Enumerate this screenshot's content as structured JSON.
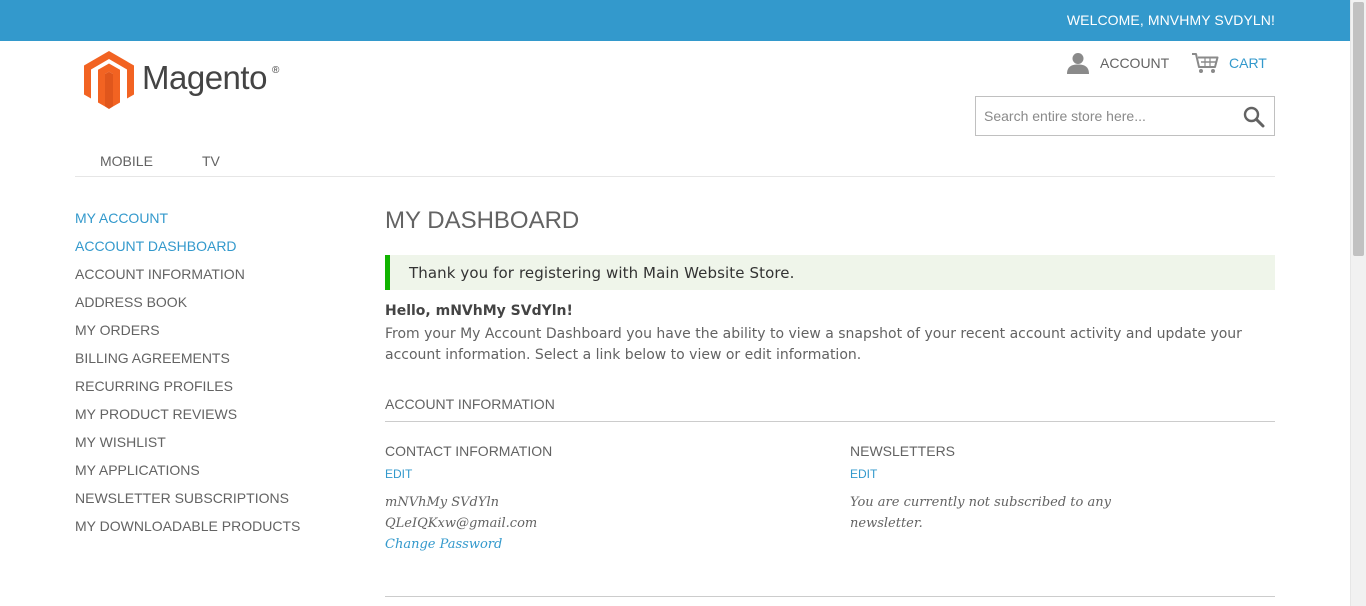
{
  "header": {
    "welcome": "WELCOME, MNVHMY SVDYLN!",
    "logo_text": "Magento",
    "account_label": "ACCOUNT",
    "cart_label": "CART",
    "search_placeholder": "Search entire store here..."
  },
  "nav": {
    "items": [
      "MOBILE",
      "TV"
    ]
  },
  "sidebar": {
    "title": "MY ACCOUNT",
    "items": [
      {
        "label": "ACCOUNT DASHBOARD",
        "active": true
      },
      {
        "label": "ACCOUNT INFORMATION"
      },
      {
        "label": "ADDRESS BOOK"
      },
      {
        "label": "MY ORDERS"
      },
      {
        "label": "BILLING AGREEMENTS"
      },
      {
        "label": "RECURRING PROFILES"
      },
      {
        "label": "MY PRODUCT REVIEWS"
      },
      {
        "label": "MY WISHLIST"
      },
      {
        "label": "MY APPLICATIONS"
      },
      {
        "label": "NEWSLETTER SUBSCRIPTIONS"
      },
      {
        "label": "MY DOWNLOADABLE PRODUCTS"
      }
    ]
  },
  "main": {
    "title": "MY DASHBOARD",
    "success_message": "Thank you for registering with Main Website Store.",
    "hello": "Hello, mNVhMy SVdYln!",
    "intro": "From your My Account Dashboard you have the ability to view a snapshot of your recent account activity and update your account information. Select a link below to view or edit information.",
    "account_info": {
      "title": "ACCOUNT INFORMATION",
      "contact": {
        "title": "CONTACT INFORMATION",
        "edit": "EDIT",
        "name": "mNVhMy SVdYln",
        "email": "QLeIQKxw@gmail.com",
        "change_password": "Change Password"
      },
      "newsletters": {
        "title": "NEWSLETTERS",
        "edit": "EDIT",
        "status_line1": "You are currently not subscribed to any",
        "status_line2": "newsletter."
      }
    }
  },
  "colors": {
    "accent": "#3399cc",
    "success_border": "#11b400",
    "success_bg": "#eff5ea",
    "logo_orange": "#f26322"
  },
  "icons": [
    "magento-logo-icon",
    "user-icon",
    "cart-icon",
    "search-icon"
  ]
}
